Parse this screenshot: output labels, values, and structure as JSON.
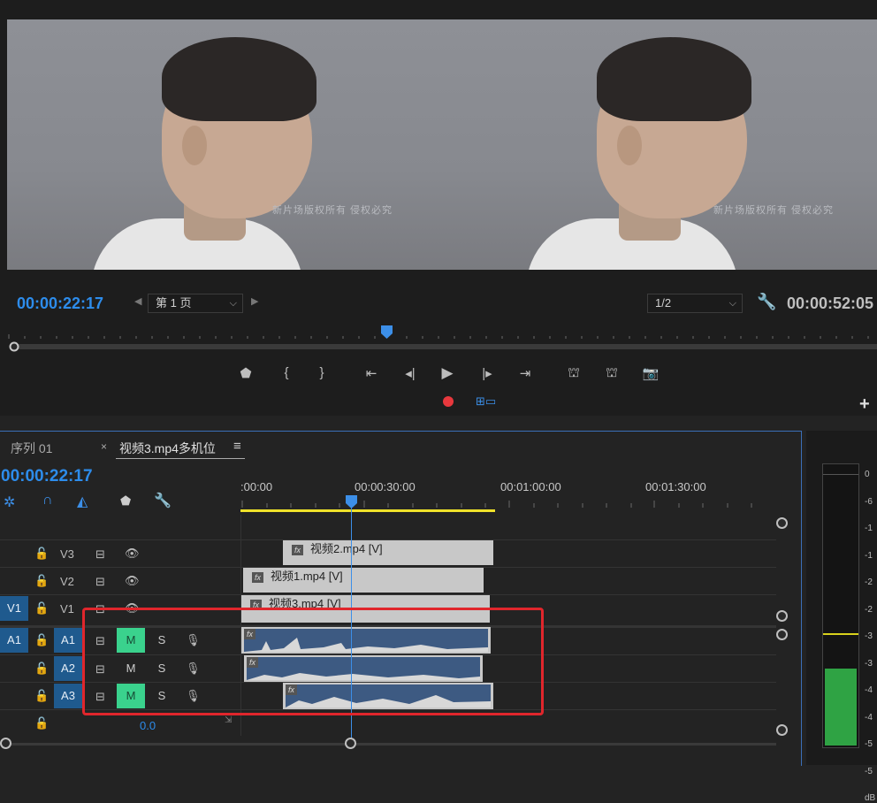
{
  "monitor": {
    "timecode_left": "00:00:22:17",
    "timecode_right": "00:00:52:05",
    "page_select": "第 1 页",
    "resolution_select": "1/2",
    "watermark": "新片场版权所有  侵权必究",
    "colors": {
      "timecode": "#2d8ceb",
      "record": "#e8383d"
    }
  },
  "timeline": {
    "tabs": [
      {
        "label": "序列 01",
        "active": false
      },
      {
        "label": "视频3.mp4多机位",
        "active": true
      }
    ],
    "tab_close": "×",
    "menu_glyph": "≡",
    "timecode": "00:00:22:17",
    "ruler": ":00:00",
    "ruler_labels": [
      "00:00:30:00",
      "00:01:00:00",
      "00:01:30:00"
    ],
    "tracks": {
      "video": [
        {
          "name": "V3",
          "clip": "视频2.mp4 [V]"
        },
        {
          "name": "V2",
          "clip": "视频1.mp4 [V]"
        },
        {
          "name": "V1",
          "clip": "视频3.mp4 [V]",
          "source": "V1"
        }
      ],
      "audio": [
        {
          "name": "A1",
          "source": "A1",
          "mute_on": true
        },
        {
          "name": "A2",
          "mute_on": false
        },
        {
          "name": "A3",
          "mute_on": true
        }
      ],
      "mute_label": "M",
      "solo_label": "S",
      "volume": "0.0"
    }
  },
  "meter": {
    "labels": [
      "0",
      "-6",
      "-1",
      "-1",
      "-2",
      "-2",
      "-3",
      "-3",
      "-4",
      "-4",
      "-5",
      "-5",
      "dB"
    ],
    "level_fraction": 0.3
  }
}
